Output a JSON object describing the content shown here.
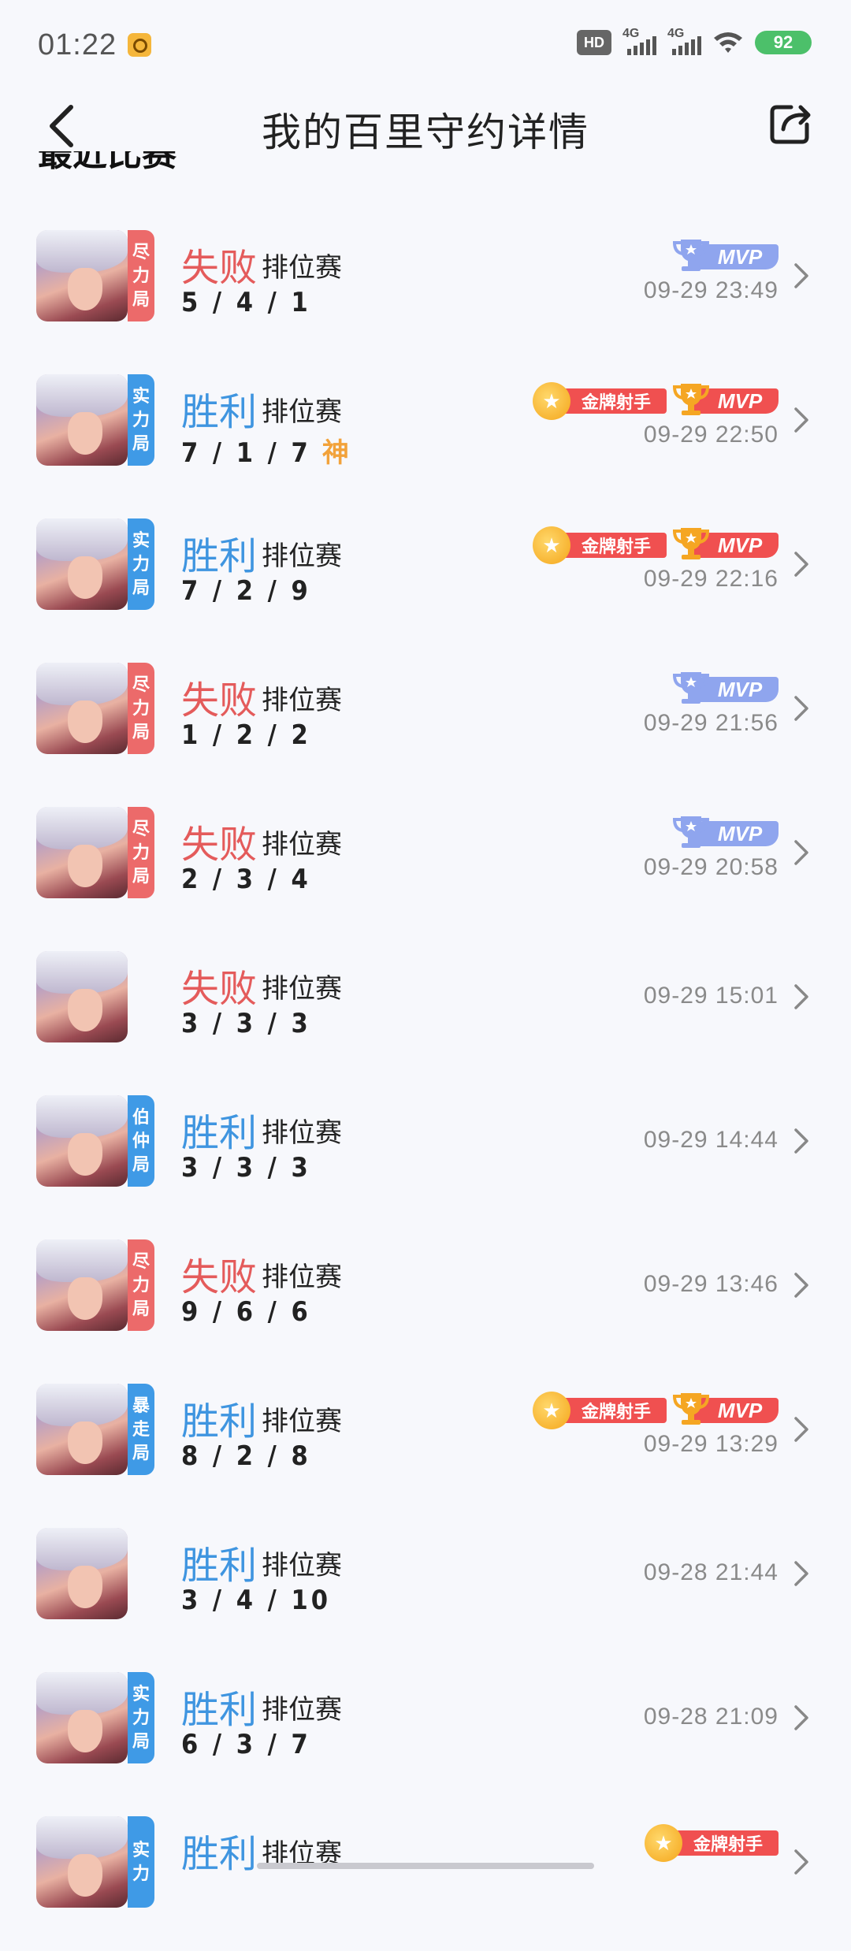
{
  "status_bar": {
    "time": "01:22",
    "hd_label": "HD",
    "sim1_label": "4G",
    "sim2_label": "4G",
    "battery": "92"
  },
  "header": {
    "title": "我的百里守约详情"
  },
  "section_title": "最近比赛",
  "colors": {
    "lose": "#e45b5b",
    "win": "#3f95e0",
    "mvp_gold": "#f05050",
    "mvp_silver": "#8fa5ee"
  },
  "matches": [
    {
      "result": "失败",
      "outcome": "lose",
      "type": "排位赛",
      "kda": "5 / 4 / 1",
      "god": "",
      "time": "09-29 23:49",
      "mode": [
        "尽",
        "力",
        "局"
      ],
      "mode_color": "red",
      "gold_label": "",
      "mvp_label": "MVP",
      "mvp_style": "silver"
    },
    {
      "result": "胜利",
      "outcome": "win",
      "type": "排位赛",
      "kda": "7 / 1 / 7",
      "god": "神",
      "time": "09-29 22:50",
      "mode": [
        "实",
        "力",
        "局"
      ],
      "mode_color": "blue",
      "gold_label": "金牌射手",
      "mvp_label": "MVP",
      "mvp_style": "gold"
    },
    {
      "result": "胜利",
      "outcome": "win",
      "type": "排位赛",
      "kda": "7 / 2 / 9",
      "god": "",
      "time": "09-29 22:16",
      "mode": [
        "实",
        "力",
        "局"
      ],
      "mode_color": "blue",
      "gold_label": "金牌射手",
      "mvp_label": "MVP",
      "mvp_style": "gold"
    },
    {
      "result": "失败",
      "outcome": "lose",
      "type": "排位赛",
      "kda": "1 / 2 / 2",
      "god": "",
      "time": "09-29 21:56",
      "mode": [
        "尽",
        "力",
        "局"
      ],
      "mode_color": "red",
      "gold_label": "",
      "mvp_label": "MVP",
      "mvp_style": "silver"
    },
    {
      "result": "失败",
      "outcome": "lose",
      "type": "排位赛",
      "kda": "2 / 3 / 4",
      "god": "",
      "time": "09-29 20:58",
      "mode": [
        "尽",
        "力",
        "局"
      ],
      "mode_color": "red",
      "gold_label": "",
      "mvp_label": "MVP",
      "mvp_style": "silver"
    },
    {
      "result": "失败",
      "outcome": "lose",
      "type": "排位赛",
      "kda": "3 / 3 / 3",
      "god": "",
      "time": "09-29 15:01",
      "mode": [],
      "mode_color": "",
      "gold_label": "",
      "mvp_label": "",
      "mvp_style": ""
    },
    {
      "result": "胜利",
      "outcome": "win",
      "type": "排位赛",
      "kda": "3 / 3 / 3",
      "god": "",
      "time": "09-29 14:44",
      "mode": [
        "伯",
        "仲",
        "局"
      ],
      "mode_color": "blue",
      "gold_label": "",
      "mvp_label": "",
      "mvp_style": ""
    },
    {
      "result": "失败",
      "outcome": "lose",
      "type": "排位赛",
      "kda": "9 / 6 / 6",
      "god": "",
      "time": "09-29 13:46",
      "mode": [
        "尽",
        "力",
        "局"
      ],
      "mode_color": "red",
      "gold_label": "",
      "mvp_label": "",
      "mvp_style": ""
    },
    {
      "result": "胜利",
      "outcome": "win",
      "type": "排位赛",
      "kda": "8 / 2 / 8",
      "god": "",
      "time": "09-29 13:29",
      "mode": [
        "暴",
        "走",
        "局"
      ],
      "mode_color": "blue",
      "gold_label": "金牌射手",
      "mvp_label": "MVP",
      "mvp_style": "gold"
    },
    {
      "result": "胜利",
      "outcome": "win",
      "type": "排位赛",
      "kda": "3 / 4 / 10",
      "god": "",
      "time": "09-28 21:44",
      "mode": [],
      "mode_color": "",
      "gold_label": "",
      "mvp_label": "",
      "mvp_style": ""
    },
    {
      "result": "胜利",
      "outcome": "win",
      "type": "排位赛",
      "kda": "6 / 3 / 7",
      "god": "",
      "time": "09-28 21:09",
      "mode": [
        "实",
        "力",
        "局"
      ],
      "mode_color": "blue",
      "gold_label": "",
      "mvp_label": "",
      "mvp_style": ""
    },
    {
      "result": "胜利",
      "outcome": "win",
      "type": "排位赛",
      "kda": "",
      "god": "",
      "time": "",
      "mode": [
        "实",
        "力"
      ],
      "mode_color": "blue",
      "gold_label": "金牌射手",
      "mvp_label": "",
      "mvp_style": ""
    }
  ]
}
